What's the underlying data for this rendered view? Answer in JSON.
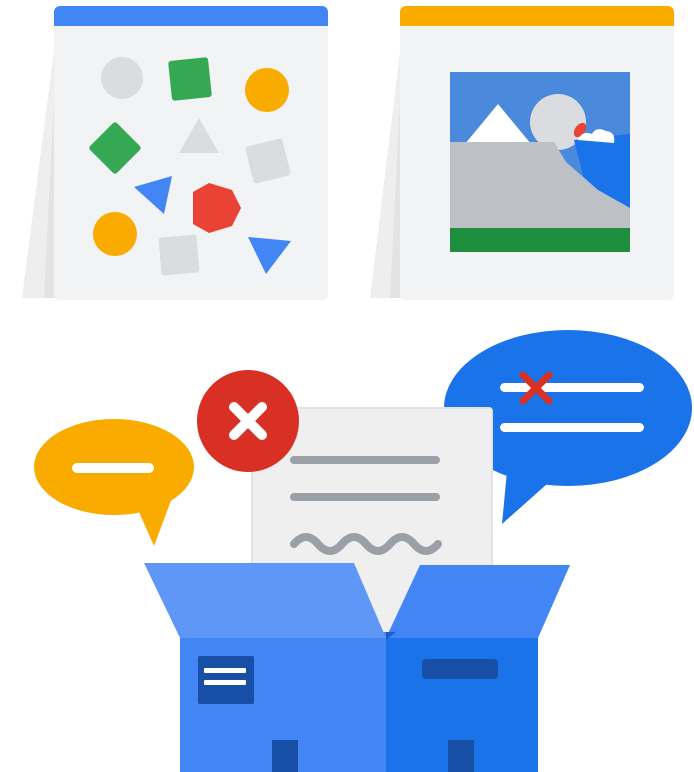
{
  "illustration": {
    "left_card": {
      "accent_color": "#4285F4",
      "icon": "shapes-collage-icon",
      "shapes": [
        {
          "kind": "circle",
          "color": "#DADCE0"
        },
        {
          "kind": "square",
          "color": "#34A853"
        },
        {
          "kind": "circle",
          "color": "#F9AB00"
        },
        {
          "kind": "diamond",
          "color": "#34A853"
        },
        {
          "kind": "triangle",
          "color": "#DADCE0"
        },
        {
          "kind": "diamond",
          "color": "#DADCE0"
        },
        {
          "kind": "triangle",
          "color": "#4285F4"
        },
        {
          "kind": "hexagon",
          "color": "#EA4335"
        },
        {
          "kind": "circle",
          "color": "#F9AB00"
        },
        {
          "kind": "square",
          "color": "#DADCE0"
        },
        {
          "kind": "triangle",
          "color": "#4285F4"
        }
      ]
    },
    "right_card": {
      "accent_color": "#F9AB00",
      "icon": "landscape-photo-icon"
    },
    "box": {
      "icon": "open-box-icon",
      "colors": {
        "front": "#4285F4",
        "side": "#1A73E8",
        "label": "#174EA6"
      }
    },
    "document": {
      "icon": "document-icon"
    },
    "reject_badge": {
      "icon": "close-icon",
      "color": "#D93025"
    },
    "yellow_bubble": {
      "icon": "chat-bubble-icon",
      "color": "#F9AB00"
    },
    "blue_bubble": {
      "icon": "chat-bubble-icon",
      "color": "#1A73E8",
      "mark": "strike-x-icon"
    }
  }
}
